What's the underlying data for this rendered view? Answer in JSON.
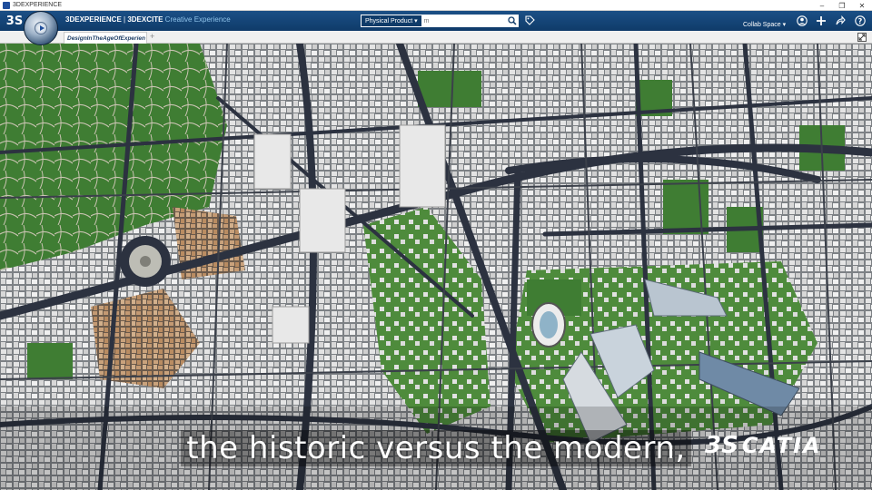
{
  "window": {
    "title": "3DEXPERIENCE",
    "minimize": "–",
    "maximize": "❐",
    "close": "✕"
  },
  "topbar": {
    "logo": "3S",
    "brand": "3DEXPERIENCE",
    "separator": " | ",
    "app": "3DEXCITE",
    "app_sub": " Creative Experience",
    "search_scope": "Physical Product",
    "search_placeholder": "m",
    "collab_space": "Collab Space",
    "icons": [
      "search-icon",
      "tag-icon",
      "user-icon",
      "add-icon",
      "share-icon",
      "help-icon"
    ]
  },
  "tabs": [
    {
      "label": "DesignInTheAgeOfExperien"
    }
  ],
  "tab_add": "+",
  "caption": "the historic versus the modern,",
  "brand_watermark": {
    "symbol": "3S",
    "word": "CATIA"
  },
  "colors": {
    "topbar": "#0f3b69",
    "accent": "#1f4e9c",
    "park": "#3e7a32",
    "road": "#2f3540",
    "building": "#d9d9d9"
  }
}
